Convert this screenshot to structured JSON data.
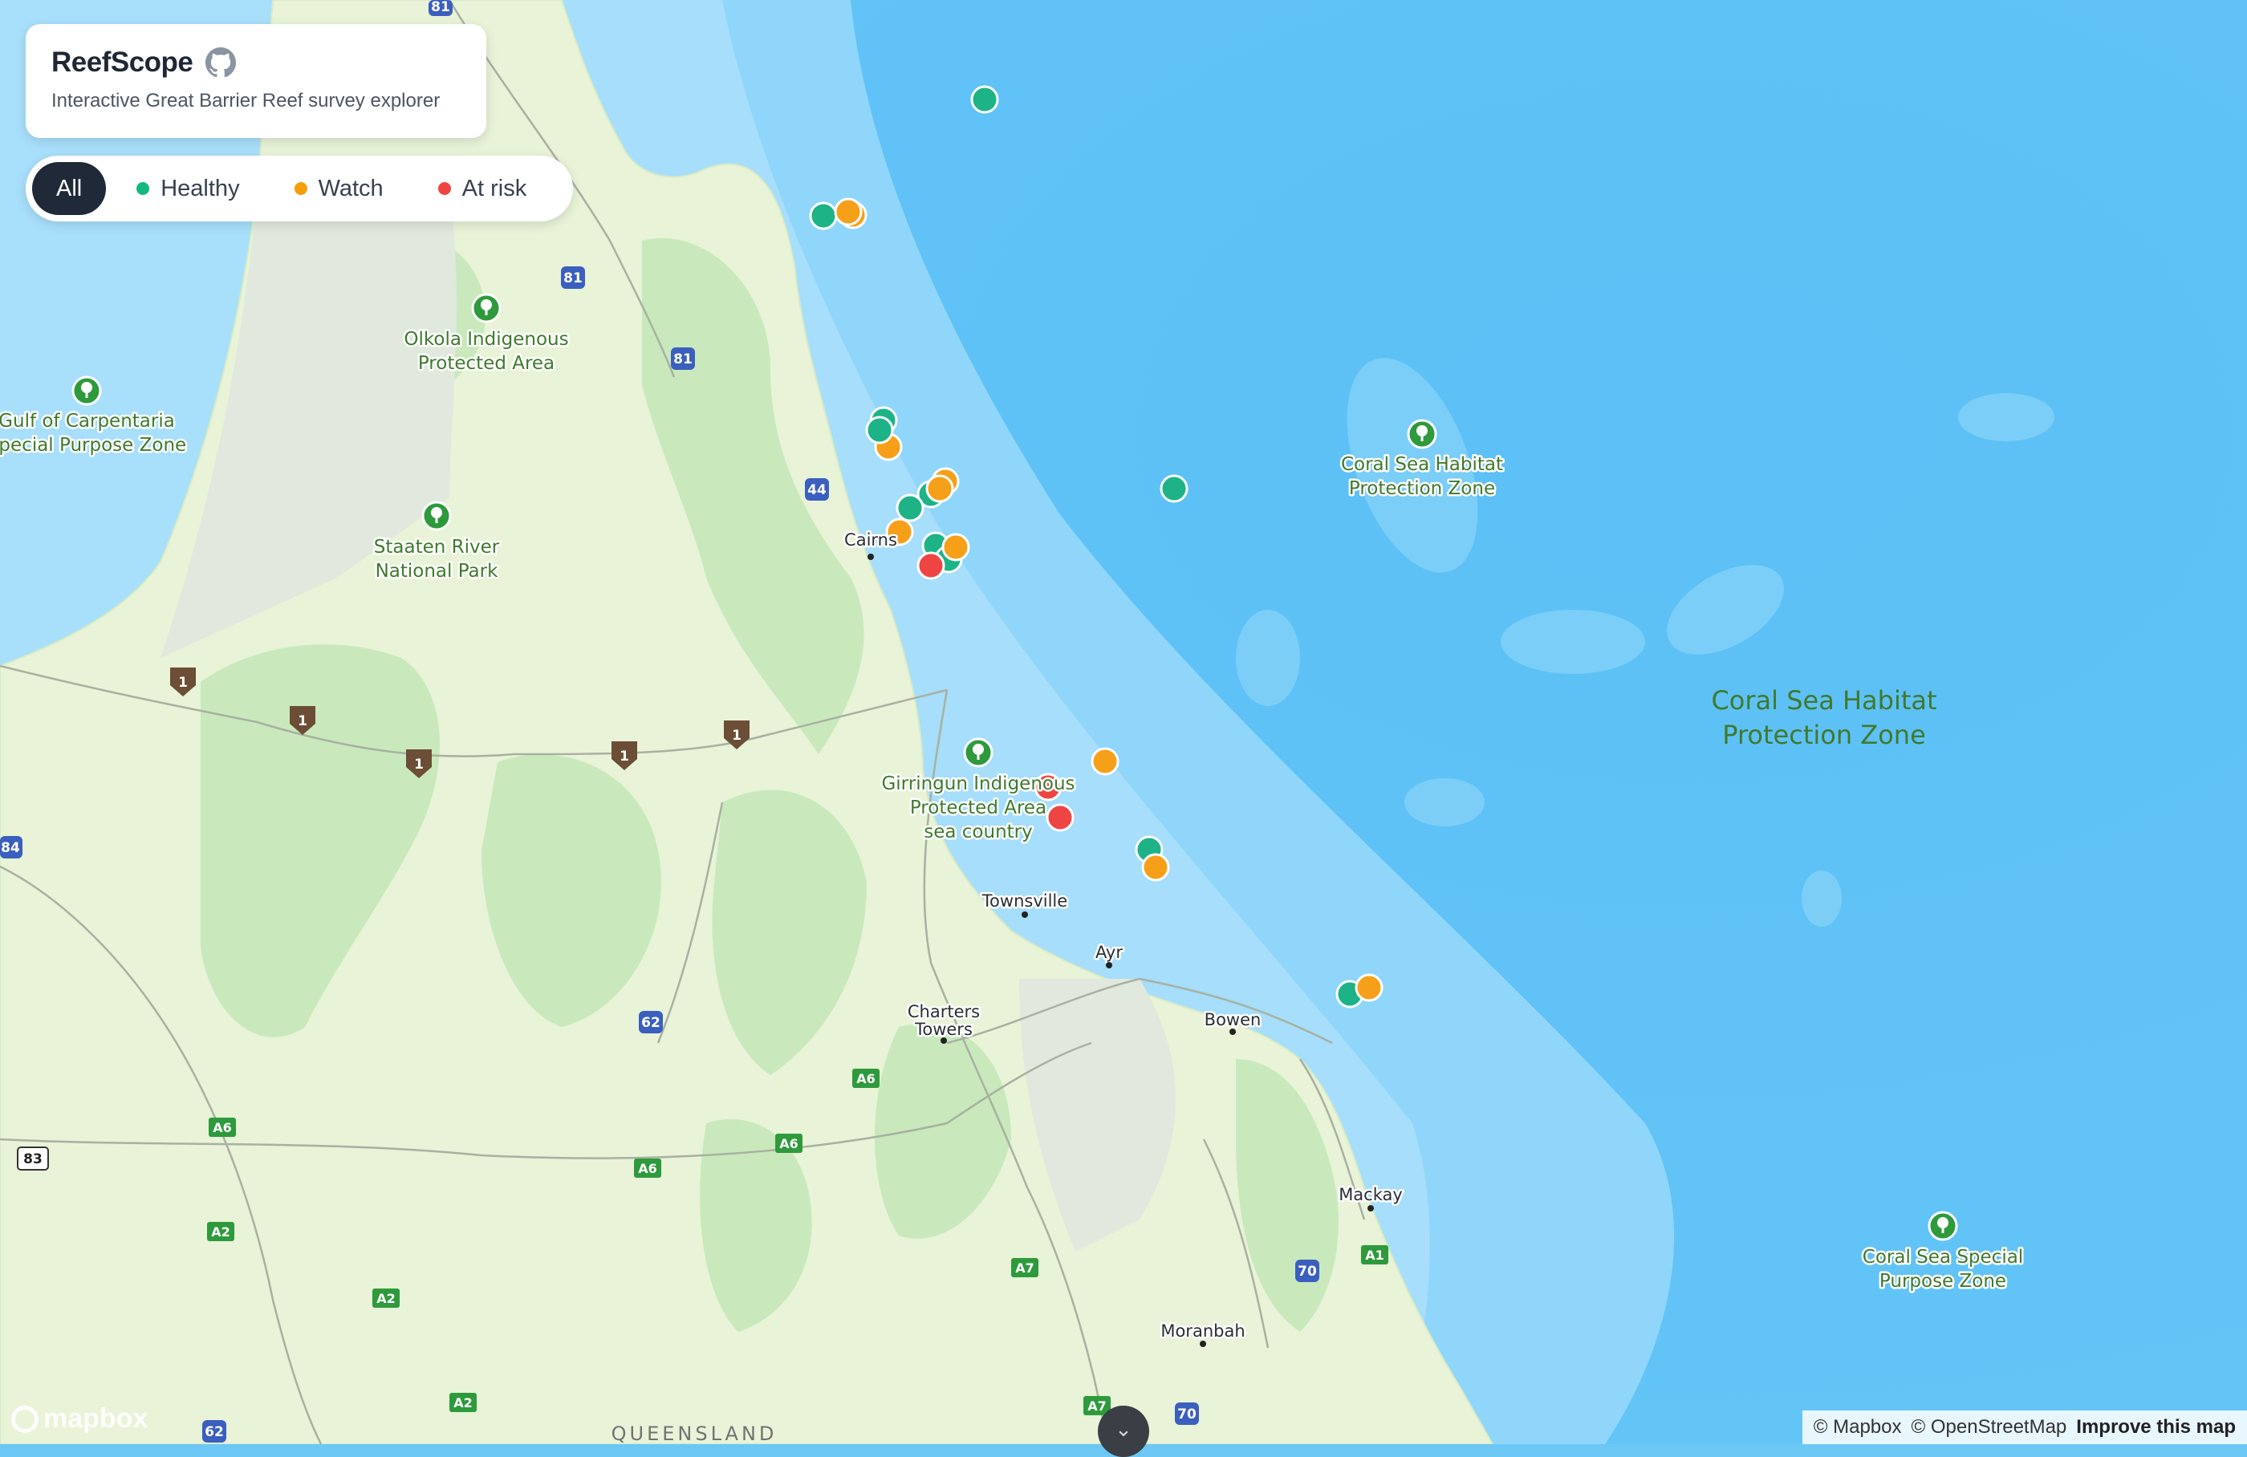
{
  "app": {
    "title": "ReefScope",
    "subtitle": "Interactive Great Barrier Reef survey explorer",
    "github_icon": "github-icon"
  },
  "filters": [
    {
      "label": "All",
      "active": true,
      "color": ""
    },
    {
      "label": "Healthy",
      "active": false,
      "color": "#10b981"
    },
    {
      "label": "Watch",
      "active": false,
      "color": "#f59e0b"
    },
    {
      "label": "At risk",
      "active": false,
      "color": "#ef4444"
    }
  ],
  "status_colors": {
    "healthy": "#1db386",
    "watch": "#f6a01a",
    "at_risk": "#ef4444"
  },
  "map_colors": {
    "land": "#e7f3d6",
    "forest": "#c8e8bb",
    "ocean_shallow": "#9ddcfb",
    "ocean_deep": "#5ec2f7"
  },
  "places": {
    "olkola": [
      "Olkola Indigenous",
      "Protected Area"
    ],
    "gulf": [
      "Gulf of Carpentaria",
      "Special Purpose Zone"
    ],
    "staaten": [
      "Staaten River",
      "National Park"
    ],
    "coral_sea_small": [
      "Coral Sea Habitat",
      "Protection Zone"
    ],
    "coral_sea_large": [
      "Coral Sea Habitat",
      "Protection Zone"
    ],
    "girringun": [
      "Girringun Indigenous",
      "Protected Area",
      "sea country"
    ],
    "coral_sea_special": [
      "Coral Sea Special",
      "Purpose Zone"
    ],
    "charters": [
      "Charters",
      "Towers"
    ],
    "cairns": "Cairns",
    "townsville": "Townsville",
    "ayr": "Ayr",
    "bowen": "Bowen",
    "mackay": "Mackay",
    "moranbah": "Moranbah",
    "queensland": "QUEENSLAND"
  },
  "roads": {
    "r81": "81",
    "r44": "44",
    "r1": "1",
    "r84": "84",
    "r83": "83",
    "r62": "62",
    "a6": "A6",
    "a2": "A2",
    "a7": "A7",
    "a1": "A1",
    "r70": "70"
  },
  "attribution": {
    "mapbox": "© Mapbox",
    "osm": "© OpenStreetMap",
    "improve": "Improve this map"
  },
  "logo": "mapbox"
}
